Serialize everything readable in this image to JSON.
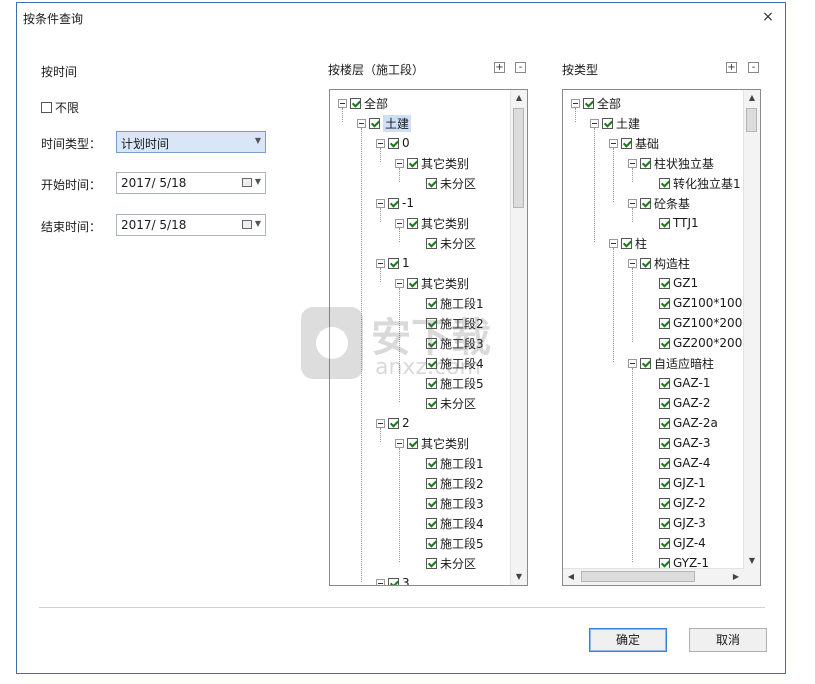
{
  "dialog": {
    "title": "按条件查询",
    "close_glyph": "×"
  },
  "time": {
    "section_label": "按时间",
    "unlimited_label": "不限",
    "unlimited_checked": false,
    "type_label": "时间类型：",
    "type_value": "计划时间",
    "start_label": "开始时间：",
    "start_value": "2017/  5/18",
    "end_label": "结束时间：",
    "end_value": "2017/  5/18"
  },
  "floor_panel": {
    "label": "按楼层（施工段）",
    "plus": "+",
    "minus": "-",
    "nodes": [
      {
        "text": "全部",
        "level": 0,
        "exp": true
      },
      {
        "text": "土建",
        "level": 1,
        "exp": true,
        "sel": true
      },
      {
        "text": "0",
        "level": 2,
        "exp": true
      },
      {
        "text": "其它类别",
        "level": 3,
        "exp": true
      },
      {
        "text": "未分区",
        "level": 4,
        "exp": false
      },
      {
        "text": "-1",
        "level": 2,
        "exp": true
      },
      {
        "text": "其它类别",
        "level": 3,
        "exp": true
      },
      {
        "text": "未分区",
        "level": 4,
        "exp": false
      },
      {
        "text": "1",
        "level": 2,
        "exp": true
      },
      {
        "text": "其它类别",
        "level": 3,
        "exp": true
      },
      {
        "text": "施工段1",
        "level": 4,
        "exp": false
      },
      {
        "text": "施工段2",
        "level": 4,
        "exp": false
      },
      {
        "text": "施工段3",
        "level": 4,
        "exp": false
      },
      {
        "text": "施工段4",
        "level": 4,
        "exp": false
      },
      {
        "text": "施工段5",
        "level": 4,
        "exp": false
      },
      {
        "text": "未分区",
        "level": 4,
        "exp": false
      },
      {
        "text": "2",
        "level": 2,
        "exp": true
      },
      {
        "text": "其它类别",
        "level": 3,
        "exp": true
      },
      {
        "text": "施工段1",
        "level": 4,
        "exp": false
      },
      {
        "text": "施工段2",
        "level": 4,
        "exp": false
      },
      {
        "text": "施工段3",
        "level": 4,
        "exp": false
      },
      {
        "text": "施工段4",
        "level": 4,
        "exp": false
      },
      {
        "text": "施工段5",
        "level": 4,
        "exp": false
      },
      {
        "text": "未分区",
        "level": 4,
        "exp": false
      },
      {
        "text": "3",
        "level": 2,
        "exp": true
      }
    ]
  },
  "type_panel": {
    "label": "按类型",
    "plus": "+",
    "minus": "-",
    "nodes": [
      {
        "text": "全部",
        "level": 0,
        "exp": true
      },
      {
        "text": "土建",
        "level": 1,
        "exp": true
      },
      {
        "text": "基础",
        "level": 2,
        "exp": true
      },
      {
        "text": "柱状独立基",
        "level": 3,
        "exp": true
      },
      {
        "text": "转化独立基1",
        "level": 4,
        "exp": false
      },
      {
        "text": "砼条基",
        "level": 3,
        "exp": true
      },
      {
        "text": "TTJ1",
        "level": 4,
        "exp": false
      },
      {
        "text": "柱",
        "level": 2,
        "exp": true
      },
      {
        "text": "构造柱",
        "level": 3,
        "exp": true
      },
      {
        "text": "GZ1",
        "level": 4,
        "exp": false
      },
      {
        "text": "GZ100*100",
        "level": 4,
        "exp": false
      },
      {
        "text": "GZ100*200",
        "level": 4,
        "exp": false
      },
      {
        "text": "GZ200*200",
        "level": 4,
        "exp": false
      },
      {
        "text": "自适应暗柱",
        "level": 3,
        "exp": true
      },
      {
        "text": "GAZ-1",
        "level": 4,
        "exp": false
      },
      {
        "text": "GAZ-2",
        "level": 4,
        "exp": false
      },
      {
        "text": "GAZ-2a",
        "level": 4,
        "exp": false
      },
      {
        "text": "GAZ-3",
        "level": 4,
        "exp": false
      },
      {
        "text": "GAZ-4",
        "level": 4,
        "exp": false
      },
      {
        "text": "GJZ-1",
        "level": 4,
        "exp": false
      },
      {
        "text": "GJZ-2",
        "level": 4,
        "exp": false
      },
      {
        "text": "GJZ-3",
        "level": 4,
        "exp": false
      },
      {
        "text": "GJZ-4",
        "level": 4,
        "exp": false
      },
      {
        "text": "GYZ-1",
        "level": 4,
        "exp": false
      }
    ]
  },
  "buttons": {
    "ok": "确定",
    "cancel": "取消"
  },
  "watermark": {
    "text": "安下载",
    "sub": "anxz.com"
  },
  "colors": {
    "border": "#3c6fb0",
    "selection": "#cfe0f6",
    "check": "#1a7a1a"
  }
}
